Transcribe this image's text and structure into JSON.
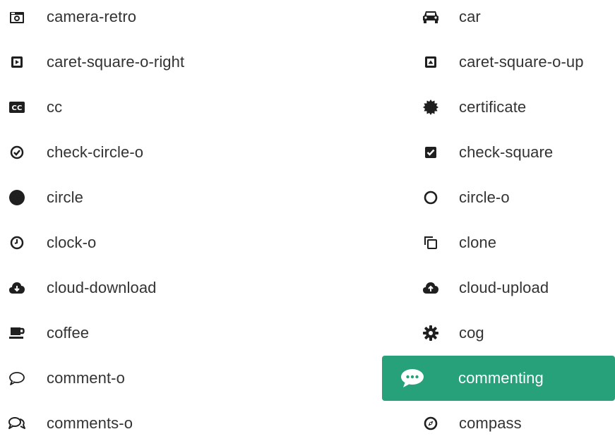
{
  "left_column": [
    {
      "name": "camera-retro",
      "label": "camera-retro"
    },
    {
      "name": "caret-square-o-right",
      "label": "caret-square-o-right"
    },
    {
      "name": "cc",
      "label": "cc"
    },
    {
      "name": "check-circle-o",
      "label": "check-circle-o"
    },
    {
      "name": "circle",
      "label": "circle"
    },
    {
      "name": "clock-o",
      "label": "clock-o"
    },
    {
      "name": "cloud-download",
      "label": "cloud-download"
    },
    {
      "name": "coffee",
      "label": "coffee"
    },
    {
      "name": "comment-o",
      "label": "comment-o"
    },
    {
      "name": "comments-o",
      "label": "comments-o"
    }
  ],
  "right_column": [
    {
      "name": "car",
      "label": "car"
    },
    {
      "name": "caret-square-o-up",
      "label": "caret-square-o-up"
    },
    {
      "name": "certificate",
      "label": "certificate"
    },
    {
      "name": "check-square",
      "label": "check-square"
    },
    {
      "name": "circle-o",
      "label": "circle-o"
    },
    {
      "name": "clone",
      "label": "clone"
    },
    {
      "name": "cloud-upload",
      "label": "cloud-upload"
    },
    {
      "name": "cog",
      "label": "cog"
    },
    {
      "name": "commenting",
      "label": "commenting",
      "active": true
    },
    {
      "name": "compass",
      "label": "compass"
    }
  ],
  "colors": {
    "text": "#333333",
    "icon": "#1f1f1f",
    "active_bg": "#26a17a",
    "active_text": "#ffffff"
  }
}
